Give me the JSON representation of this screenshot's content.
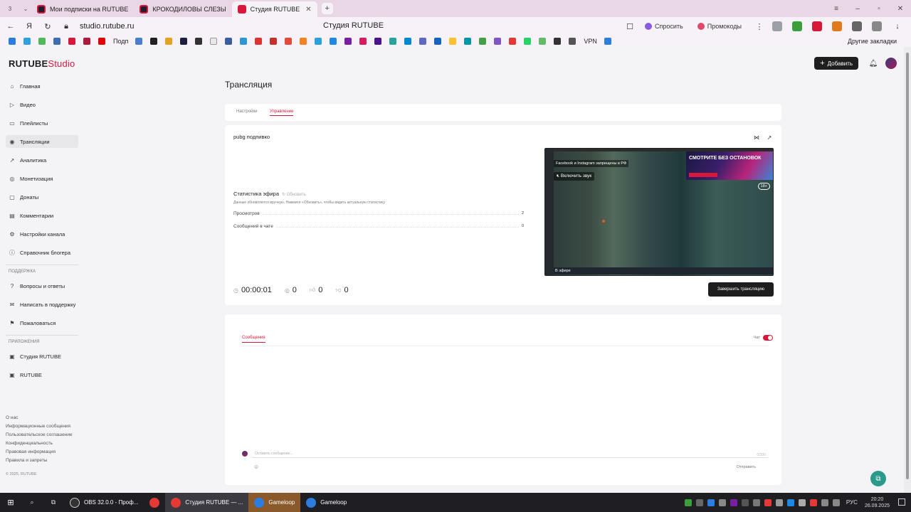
{
  "browser": {
    "tab_counter": "3",
    "tabs": [
      {
        "label": "Мои подписки на RUTUBE"
      },
      {
        "label": "КРОКОДИЛОВЫ СЛЕЗЫ"
      },
      {
        "label": "Студия RUTUBE"
      }
    ],
    "url": "studio.rutube.ru",
    "page_title": "Студия RUTUBE",
    "ask_label": "Спросить",
    "promo_label": "Промокоды",
    "bookmarks": {
      "podp_label": "Подп",
      "vpn_label": "VPN",
      "other_label": "Другие закладки"
    }
  },
  "app": {
    "logo_main": "RUTUBE",
    "logo_studio": "Studio",
    "add_label": "Добавить"
  },
  "sidebar": {
    "items": [
      {
        "label": "Главная"
      },
      {
        "label": "Видео"
      },
      {
        "label": "Плейлисты"
      },
      {
        "label": "Трансляции"
      },
      {
        "label": "Аналитика"
      },
      {
        "label": "Монетизация"
      },
      {
        "label": "Донаты"
      },
      {
        "label": "Комментарии"
      },
      {
        "label": "Настройки канала"
      },
      {
        "label": "Справочник блогера"
      }
    ],
    "support_section": "ПОДДЕРЖКА",
    "support_items": [
      {
        "label": "Вопросы и ответы"
      },
      {
        "label": "Написать в поддержку"
      },
      {
        "label": "Пожаловаться"
      }
    ],
    "apps_section": "ПРИЛОЖЕНИЯ",
    "app_items": [
      {
        "label": "Студия RUTUBE"
      },
      {
        "label": "RUTUBE"
      }
    ],
    "footer": [
      "О нас",
      "Информационные сообщения",
      "Пользовательское соглашение",
      "Конфиденциальность",
      "Правовая информация",
      "Правила и запреты"
    ],
    "copyright": "© 2025, RUTUBE"
  },
  "main": {
    "title": "Трансляция",
    "tabs": [
      {
        "label": "Настройки"
      },
      {
        "label": "Управление"
      }
    ],
    "stream_name": "pubg подпивко",
    "stats_title": "Статистика эфира",
    "stats_refresh": "Обновить",
    "stats_hint": "Данные обновляются вручную. Нажмите «Обновить», чтобы видеть актуальную статистику",
    "stats": [
      {
        "label": "Просмотров",
        "value": "2"
      },
      {
        "label": "Сообщений в чате",
        "value": "0"
      }
    ],
    "duration": "00:00:01",
    "viewers": "0",
    "likes": "0",
    "dislikes": "0",
    "video": {
      "banner": "Facebook и Instagram запрещены в РФ",
      "sound": "Включить звук",
      "ad_text": "СМОТРИТЕ БЕЗ ОСТАНОВОК",
      "age": "18+",
      "live": "В эфире"
    },
    "end_button": "Завершить трансляцию",
    "chat": {
      "tab": "Сообщения",
      "toggle_label": "Чат",
      "placeholder": "Оставить сообщение...",
      "count": "0/200",
      "send": "Отправить"
    }
  },
  "taskbar": {
    "apps": [
      {
        "label": "OBS 32.0.0 - Проф..."
      },
      {
        "label": "Студия RUTUBE — ..."
      },
      {
        "label": "Gameloop"
      },
      {
        "label": "Gameloop"
      }
    ],
    "lang": "РУС",
    "time": "20:20",
    "date": "26.09.2025"
  },
  "colors": {
    "accent": "#d8183b",
    "dark": "#1e1e1e",
    "tabbar": "#e9d7e6"
  }
}
